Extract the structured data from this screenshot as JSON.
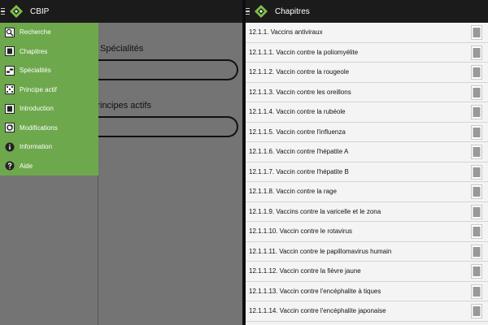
{
  "left": {
    "app_title": "CBIP",
    "sections": {
      "specialites_label": "Spécialités",
      "principes_label": "Principes actifs"
    },
    "drawer": {
      "items": [
        {
          "label": "Recherche",
          "icon": "search-icon"
        },
        {
          "label": "Chapitres",
          "icon": "book-icon"
        },
        {
          "label": "Spécialités",
          "icon": "pills-icon"
        },
        {
          "label": "Principe actif",
          "icon": "molecule-icon"
        },
        {
          "label": "Introduction",
          "icon": "book-icon"
        },
        {
          "label": "Modifications",
          "icon": "refresh-icon"
        },
        {
          "label": "Information",
          "icon": "info-icon"
        },
        {
          "label": "Aide",
          "icon": "help-icon"
        }
      ],
      "color": "#6ea84c"
    }
  },
  "right": {
    "app_title": "Chapitres",
    "rows": [
      "12.1.1. Vaccins antiviraux",
      "12.1.1.1. Vaccin contre la poliomyélite",
      "12.1.1.2. Vaccin contre la rougeole",
      "12.1.1.3. Vaccin contre les oreillons",
      "12.1.1.4. Vaccin contre la rubéole",
      "12.1.1.5. Vaccin contre l'influenza",
      "12.1.1.6. Vaccin contre l'hépatite A",
      "12.1.1.7. Vaccin contre l'hépatite B",
      "12.1.1.8. Vaccin contre la rage",
      "12.1.1.9. Vaccins contre la varicelle et le zona",
      "12.1.1.10. Vaccin contre le rotavirus",
      "12.1.1.11. Vaccin contre le papillomavirus humain",
      "12.1.1.12. Vaccin contre la fièvre jaune",
      "12.1.1.13. Vaccin contre l'encéphalite à tiques",
      "12.1.1.14. Vaccin contre l'encéphalite japonaise"
    ]
  },
  "colors": {
    "appbar": "#1b1b1b",
    "logo_green": "#7cc142",
    "drawer_green": "#6ea84c"
  }
}
